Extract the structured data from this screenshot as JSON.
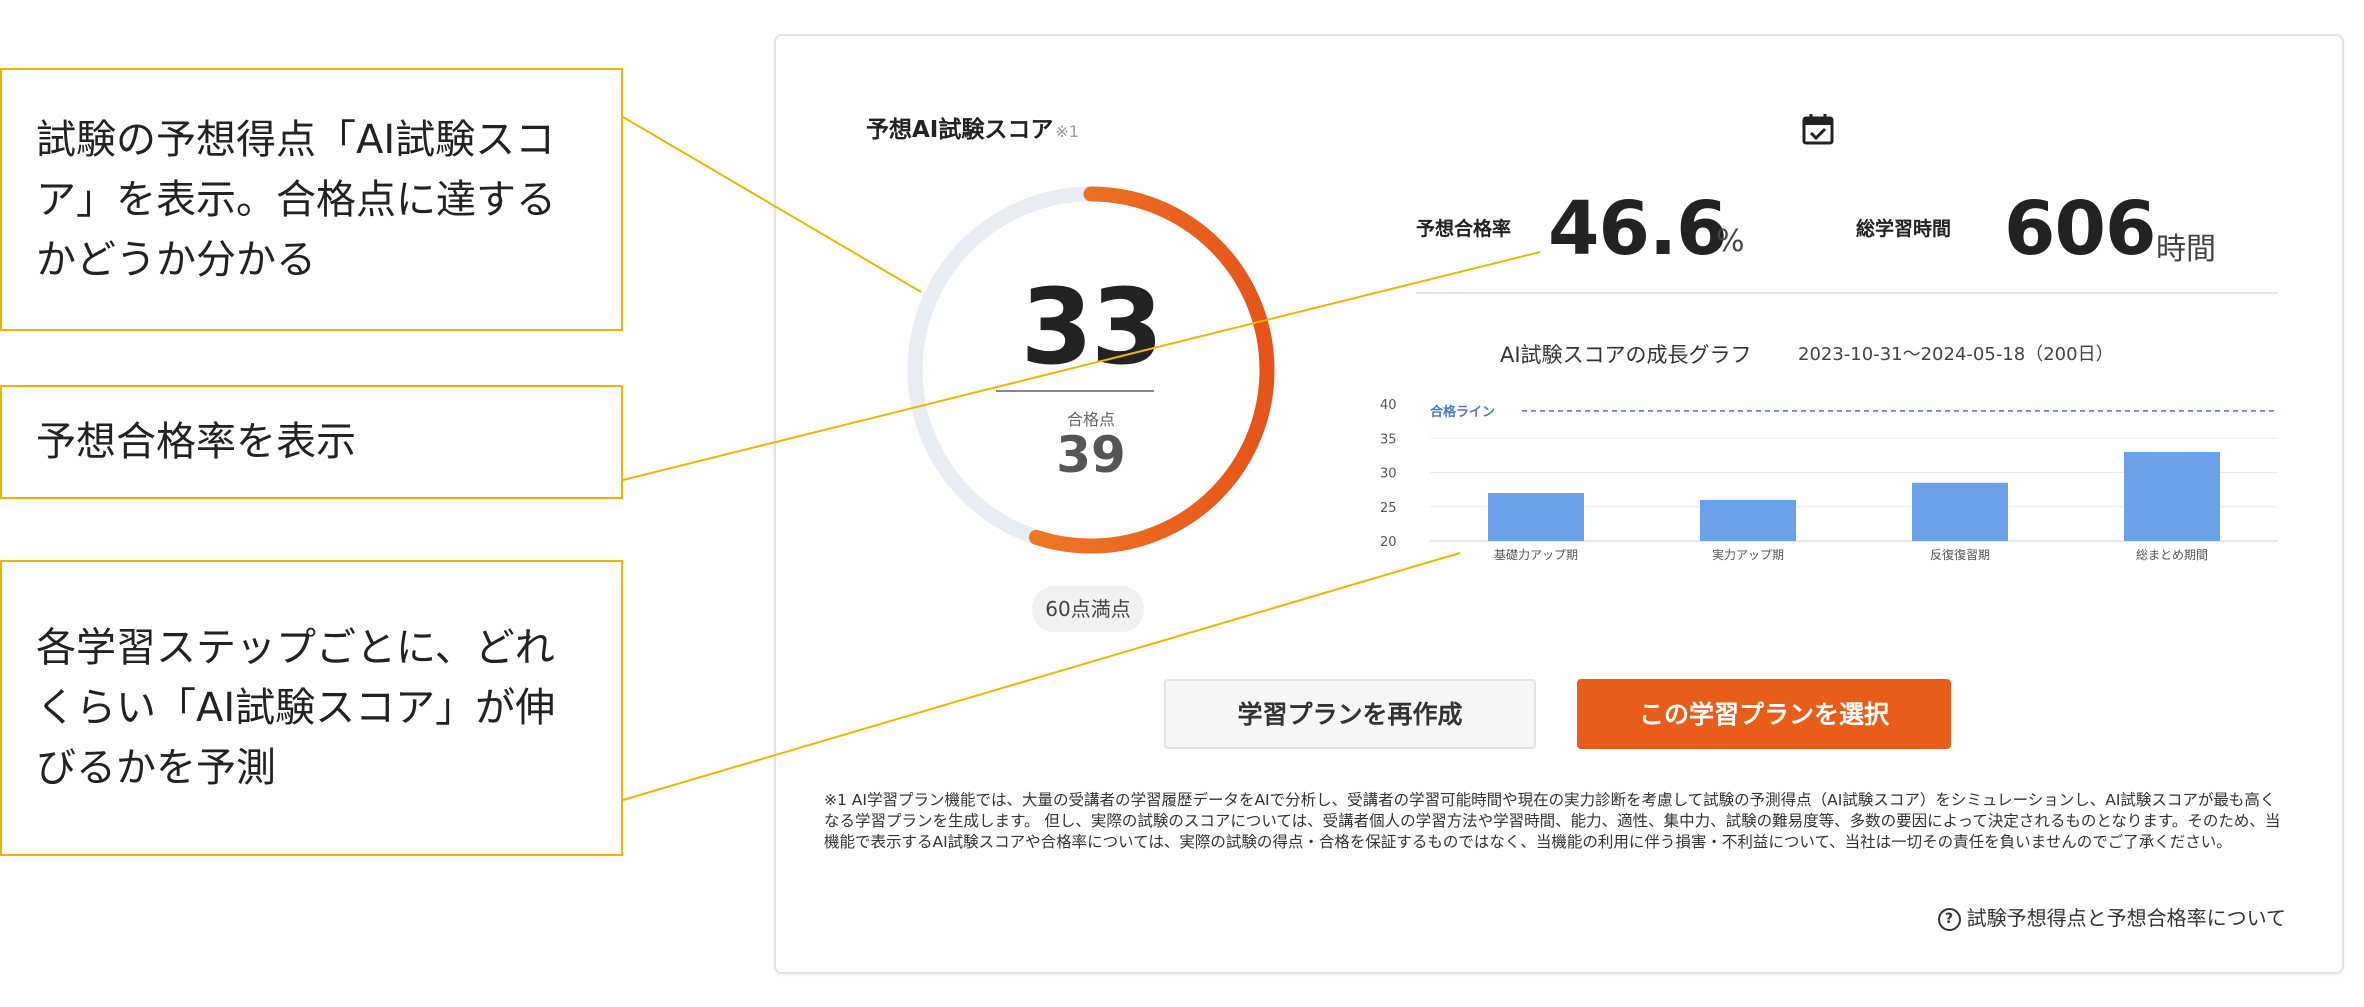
{
  "callouts": [
    "試験の予想得点「AI試験スコア」を表示。合格点に達するかどうか分かる",
    "予想合格率を表示",
    "各学習ステップごとに、どれくらい「AI試験スコア」が伸びるかを予測"
  ],
  "score_panel": {
    "title": "予想AI試験スコア",
    "title_note": "※1",
    "score": "33",
    "pass_label": "合格点",
    "pass_value": "39",
    "max_label": "60点満点",
    "gauge_fraction": 0.55
  },
  "stats": {
    "pass_rate_label": "予想合格率",
    "pass_rate_value": "46.6",
    "pass_rate_unit": "%",
    "study_time_label": "総学習時間",
    "study_time_value": "606",
    "study_time_unit": "時間"
  },
  "graph": {
    "title": "AI試験スコアの成長グラフ",
    "range": "2023-10-31〜2024-05-18（200日）"
  },
  "chart_data": {
    "type": "bar",
    "categories": [
      "基礎力アップ期",
      "実力アップ期",
      "反復復習期",
      "総まとめ期間"
    ],
    "values": [
      27,
      26,
      28.5,
      33
    ],
    "ylim": [
      20,
      40
    ],
    "yticks": [
      "20",
      "25",
      "30",
      "35",
      "40"
    ],
    "reference_line": {
      "label": "合格ライン",
      "value": 39
    },
    "bar_color": "#6ba1e9",
    "line_color": "#4a78c2"
  },
  "buttons": {
    "recreate": "学習プランを再作成",
    "select": "この学習プランを選択"
  },
  "disclaimer": "※1 AI学習プラン機能では、大量の受講者の学習履歴データをAIで分析し、受講者の学習可能時間や現在の実力診断を考慮して試験の予測得点（AI試験スコア）をシミュレーションし、AI試験スコアが最も高くなる学習プランを生成します。 但し、実際の試験のスコアについては、受講者個人の学習方法や学習時間、能力、適性、集中力、試験の難易度等、多数の要因によって決定されるものとなります。そのため、当機能で表示するAI試験スコアや合格率については、実際の試験の得点・合格を保証するものではなく、当機能の利用に伴う損害・不利益について、当社は一切その責任を負いませんのでご了承ください。",
  "help_link": "試験予想得点と予想合格率について",
  "colors": {
    "accent": "#e85d1a",
    "callout_border": "#f0b400",
    "gauge_track": "#e8ecf3"
  }
}
